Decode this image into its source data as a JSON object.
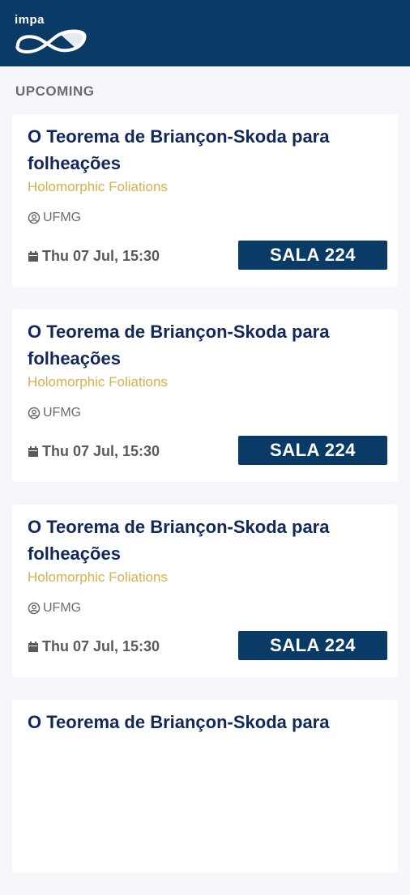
{
  "header": {
    "logo_text": "impa"
  },
  "section": {
    "label": "UPCOMING"
  },
  "events": [
    {
      "title": "O Teorema de Briançon-Skoda para folheações",
      "subtitle": "Holomorphic Foliations",
      "institution": "UFMG",
      "datetime": "Thu 07 Jul, 15:30",
      "room": "SALA 224"
    },
    {
      "title": "O Teorema de Briançon-Skoda para folheações",
      "subtitle": "Holomorphic Foliations",
      "institution": "UFMG",
      "datetime": "Thu 07 Jul, 15:30",
      "room": "SALA 224"
    },
    {
      "title": "O Teorema de Briançon-Skoda para folheações",
      "subtitle": "Holomorphic Foliations",
      "institution": "UFMG",
      "datetime": "Thu 07 Jul, 15:30",
      "room": "SALA 224"
    },
    {
      "title": "O Teorema de Briançon-Skoda para",
      "subtitle": "",
      "institution": "",
      "datetime": "",
      "room": ""
    }
  ],
  "colors": {
    "header_bg": "#0a3b66",
    "title": "#11285a",
    "subtitle": "#d6b04a",
    "room_bg": "#0a3b66"
  },
  "icons": {
    "institution": "account-circle-icon",
    "date": "calendar-icon",
    "logo": "infinity-logo-icon"
  }
}
